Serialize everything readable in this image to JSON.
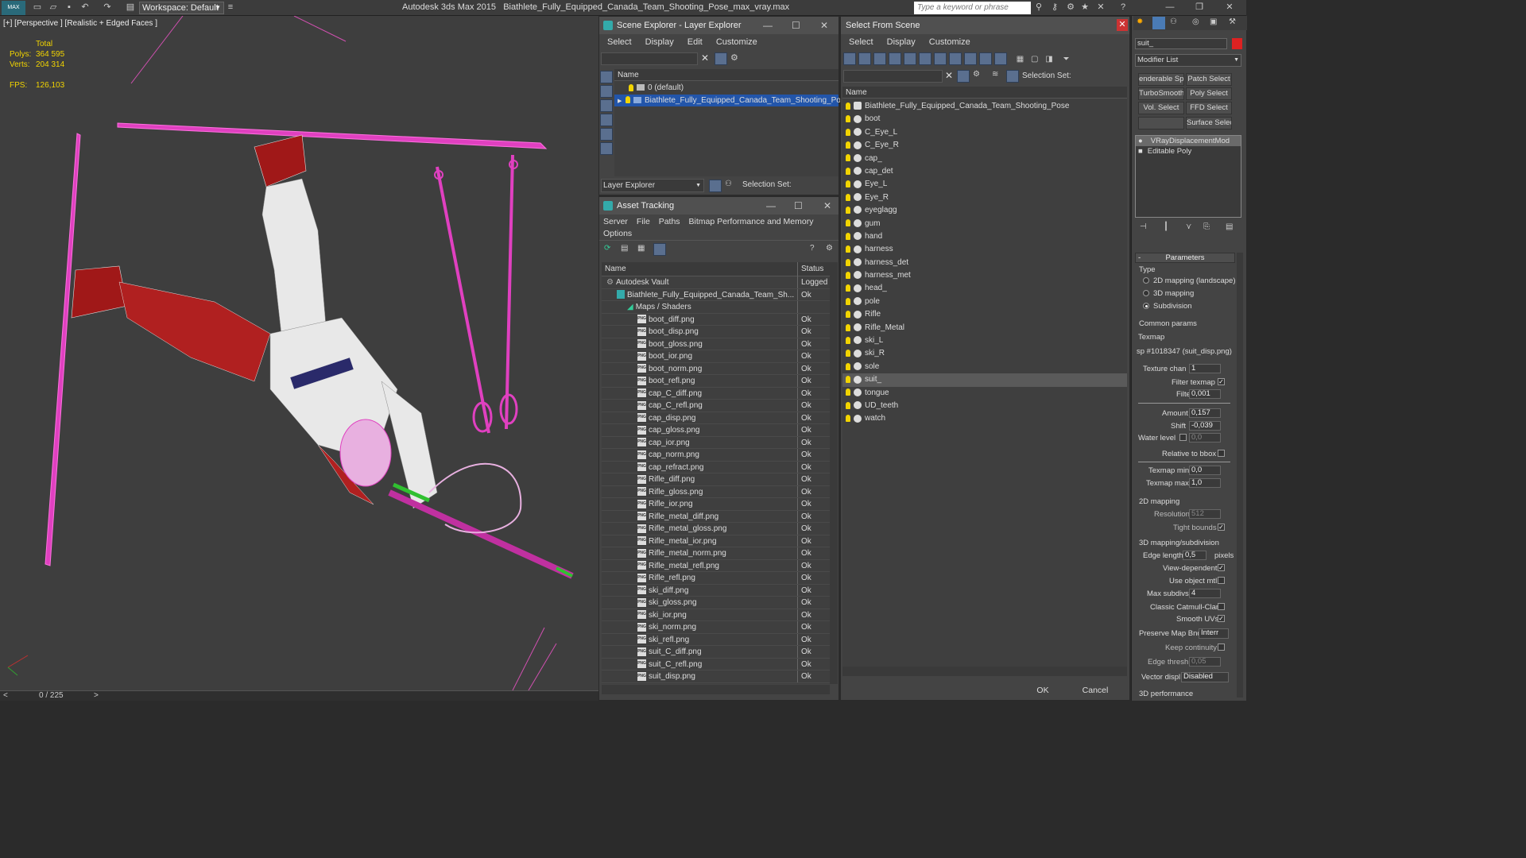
{
  "title_bar": {
    "logo": "MAX",
    "workspace": "Workspace: Default",
    "app_title": "Autodesk 3ds Max  2015",
    "file_name": "Biathlete_Fully_Equipped_Canada_Team_Shooting_Pose_max_vray.max",
    "search_placeholder": "Type a keyword or phrase"
  },
  "viewport": {
    "label": "[+] [Perspective ] [Realistic + Edged Faces ]",
    "stats": {
      "total_label": "Total",
      "polys_label": "Polys:",
      "polys": "364 595",
      "verts_label": "Verts:",
      "verts": "204 314",
      "fps_label": "FPS:",
      "fps": "126,103"
    },
    "timeline": "0 / 225"
  },
  "scene_explorer": {
    "title": "Scene Explorer - Layer Explorer",
    "menu": [
      "Select",
      "Display",
      "Edit",
      "Customize"
    ],
    "column": "Name",
    "rows": [
      {
        "label": "0 (default)",
        "selected": false
      },
      {
        "label": "Biathlete_Fully_Equipped_Canada_Team_Shooting_Pose",
        "selected": true
      }
    ],
    "footer_dropdown": "Layer Explorer",
    "selection_set": "Selection Set:"
  },
  "asset_tracking": {
    "title": "Asset Tracking",
    "menu": [
      "Server",
      "File",
      "Paths",
      "Bitmap Performance and Memory"
    ],
    "menu2": "Options",
    "col_name": "Name",
    "col_status": "Status",
    "rows": [
      {
        "name": "Autodesk Vault",
        "status": "Logged",
        "indent": 0
      },
      {
        "name": "Biathlete_Fully_Equipped_Canada_Team_Sh...",
        "status": "Ok",
        "indent": 1
      },
      {
        "name": "Maps / Shaders",
        "status": "",
        "indent": 2
      },
      {
        "name": "boot_diff.png",
        "status": "Ok",
        "indent": 3
      },
      {
        "name": "boot_disp.png",
        "status": "Ok",
        "indent": 3
      },
      {
        "name": "boot_gloss.png",
        "status": "Ok",
        "indent": 3
      },
      {
        "name": "boot_ior.png",
        "status": "Ok",
        "indent": 3
      },
      {
        "name": "boot_norm.png",
        "status": "Ok",
        "indent": 3
      },
      {
        "name": "boot_refl.png",
        "status": "Ok",
        "indent": 3
      },
      {
        "name": "cap_C_diff.png",
        "status": "Ok",
        "indent": 3
      },
      {
        "name": "cap_C_refl.png",
        "status": "Ok",
        "indent": 3
      },
      {
        "name": "cap_disp.png",
        "status": "Ok",
        "indent": 3
      },
      {
        "name": "cap_gloss.png",
        "status": "Ok",
        "indent": 3
      },
      {
        "name": "cap_ior.png",
        "status": "Ok",
        "indent": 3
      },
      {
        "name": "cap_norm.png",
        "status": "Ok",
        "indent": 3
      },
      {
        "name": "cap_refract.png",
        "status": "Ok",
        "indent": 3
      },
      {
        "name": "Rifle_diff.png",
        "status": "Ok",
        "indent": 3
      },
      {
        "name": "Rifle_gloss.png",
        "status": "Ok",
        "indent": 3
      },
      {
        "name": "Rifle_ior.png",
        "status": "Ok",
        "indent": 3
      },
      {
        "name": "Rifle_metal_diff.png",
        "status": "Ok",
        "indent": 3
      },
      {
        "name": "Rifle_metal_gloss.png",
        "status": "Ok",
        "indent": 3
      },
      {
        "name": "Rifle_metal_ior.png",
        "status": "Ok",
        "indent": 3
      },
      {
        "name": "Rifle_metal_norm.png",
        "status": "Ok",
        "indent": 3
      },
      {
        "name": "Rifle_metal_refl.png",
        "status": "Ok",
        "indent": 3
      },
      {
        "name": "Rifle_refl.png",
        "status": "Ok",
        "indent": 3
      },
      {
        "name": "ski_diff.png",
        "status": "Ok",
        "indent": 3
      },
      {
        "name": "ski_gloss.png",
        "status": "Ok",
        "indent": 3
      },
      {
        "name": "ski_ior.png",
        "status": "Ok",
        "indent": 3
      },
      {
        "name": "ski_norm.png",
        "status": "Ok",
        "indent": 3
      },
      {
        "name": "ski_refl.png",
        "status": "Ok",
        "indent": 3
      },
      {
        "name": "suit_C_diff.png",
        "status": "Ok",
        "indent": 3
      },
      {
        "name": "suit_C_refl.png",
        "status": "Ok",
        "indent": 3
      },
      {
        "name": "suit_disp.png",
        "status": "Ok",
        "indent": 3
      }
    ]
  },
  "select_from_scene": {
    "title": "Select From Scene",
    "menu": [
      "Select",
      "Display",
      "Customize"
    ],
    "selection_set": "Selection Set:",
    "column": "Name",
    "items": [
      {
        "label": "Biathlete_Fully_Equipped_Canada_Team_Shooting_Pose",
        "group": true,
        "selected": false
      },
      {
        "label": "boot",
        "selected": false
      },
      {
        "label": "C_Eye_L",
        "selected": false
      },
      {
        "label": "C_Eye_R",
        "selected": false
      },
      {
        "label": "cap_",
        "selected": false
      },
      {
        "label": "cap_det",
        "selected": false
      },
      {
        "label": "Eye_L",
        "selected": false
      },
      {
        "label": "Eye_R",
        "selected": false
      },
      {
        "label": "eyeglagg",
        "selected": false
      },
      {
        "label": "gum",
        "selected": false
      },
      {
        "label": "hand",
        "selected": false
      },
      {
        "label": "harness",
        "selected": false
      },
      {
        "label": "harness_det",
        "selected": false
      },
      {
        "label": "harness_met",
        "selected": false
      },
      {
        "label": "head_",
        "selected": false
      },
      {
        "label": "pole",
        "selected": false
      },
      {
        "label": "Rifle",
        "selected": false
      },
      {
        "label": "Rifle_Metal",
        "selected": false
      },
      {
        "label": "ski_L",
        "selected": false
      },
      {
        "label": "ski_R",
        "selected": false
      },
      {
        "label": "sole",
        "selected": false
      },
      {
        "label": "suit_",
        "selected": true
      },
      {
        "label": "tongue",
        "selected": false
      },
      {
        "label": "UD_teeth",
        "selected": false
      },
      {
        "label": "watch",
        "selected": false
      }
    ],
    "ok": "OK",
    "cancel": "Cancel"
  },
  "command_panel": {
    "object_name": "suit_",
    "modifier_list": "Modifier List",
    "buttons": [
      "enderable Spli",
      "Patch Select",
      "TurboSmooth",
      "Poly Select",
      "Vol. Select",
      "FFD Select",
      "",
      "Surface Select"
    ],
    "stack": [
      "VRayDisplacementMod",
      "Editable Poly"
    ],
    "parameters_title": "Parameters",
    "type_label": "Type",
    "type_options": [
      {
        "label": "2D mapping (landscape)",
        "on": false
      },
      {
        "label": "3D mapping",
        "on": false
      },
      {
        "label": "Subdivision",
        "on": true
      }
    ],
    "common_params": "Common params",
    "texmap_label": "Texmap",
    "texmap_value": "sp #1018347 (suit_disp.png)",
    "texture_chan_label": "Texture chan",
    "texture_chan": "1",
    "filter_texmap_label": "Filter texmap",
    "filter_blur_label": "Filter blur",
    "filter_blur": "0,001",
    "amount_label": "Amount",
    "amount": "0,157",
    "shift_label": "Shift",
    "shift": "-0,039",
    "water_level_label": "Water level",
    "water_level": "0,0",
    "relative_bbox_label": "Relative to bbox",
    "texmap_min_label": "Texmap min",
    "texmap_min": "0,0",
    "texmap_max_label": "Texmap max",
    "texmap_max": "1,0",
    "mapping2d_title": "2D mapping",
    "resolution_label": "Resolution",
    "resolution": "512",
    "tight_bounds_label": "Tight bounds",
    "mapping3d_title": "3D mapping/subdivision",
    "edge_length_label": "Edge length",
    "edge_length": "0,5",
    "pixels_label": "pixels",
    "view_dependent_label": "View-dependent",
    "use_object_mtl_label": "Use object mtl",
    "max_subdivs_label": "Max subdivs",
    "max_subdivs": "4",
    "classic_cc_label": "Classic Catmull-Clark",
    "smooth_uvs_label": "Smooth UVs",
    "preserve_map_label": "Preserve Map Bnd",
    "preserve_map": "Interr",
    "keep_continuity_label": "Keep continuity",
    "edge_thresh_label": "Edge thresh",
    "edge_thresh": "0,05",
    "vector_displ_label": "Vector displ",
    "vector_displ": "Disabled",
    "performance_title": "3D performance"
  },
  "colors": {
    "wire_magenta": "#e040c0",
    "suit_red": "#a01818",
    "stats_yellow": "#f2d400",
    "selection_blue": "#2255aa"
  }
}
